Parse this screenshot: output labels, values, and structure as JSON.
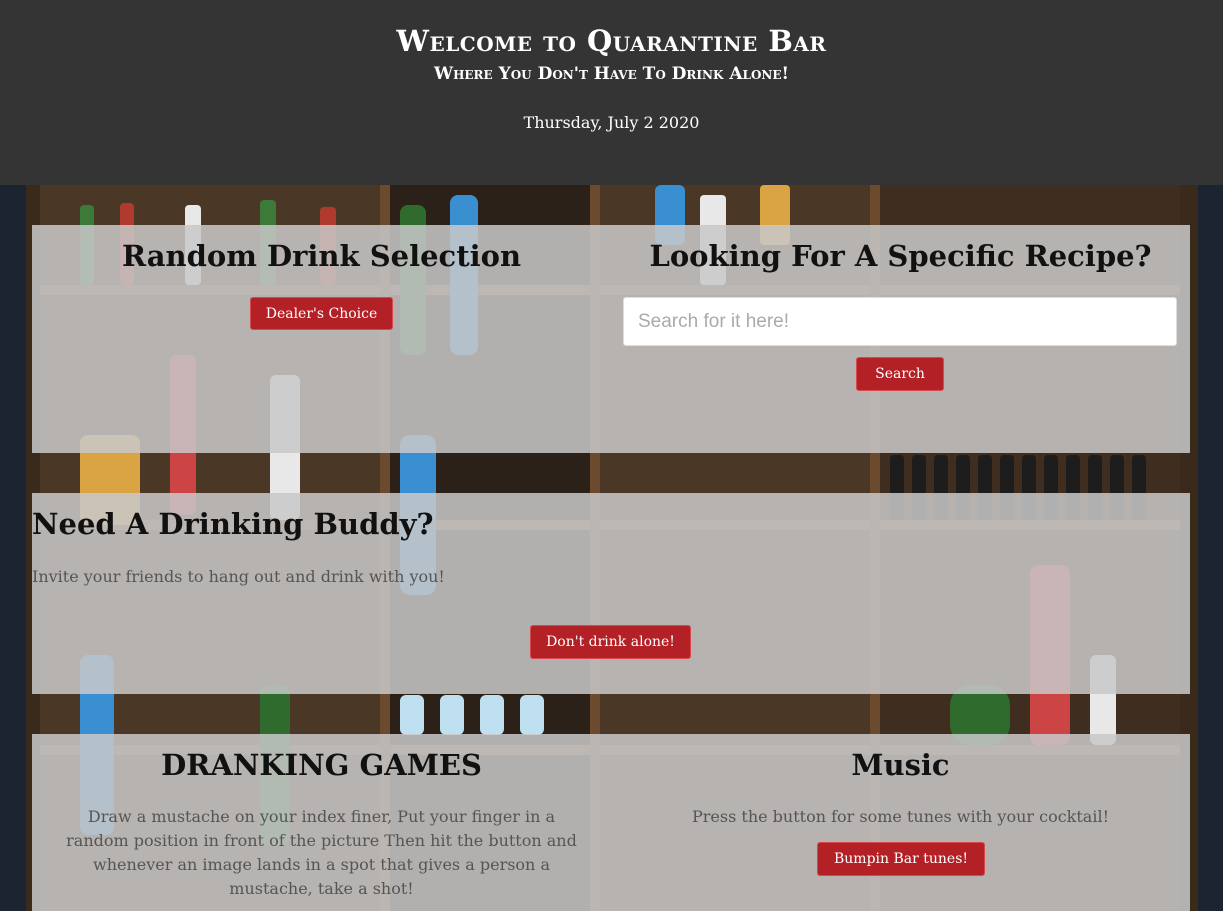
{
  "header": {
    "title": "Welcome to Quarantine Bar",
    "subtitle": "Where You Don't Have To Drink Alone!",
    "date": "Thursday, July 2 2020"
  },
  "random_drink": {
    "heading": "Random Drink Selection",
    "button_label": "Dealer's Choice"
  },
  "recipe_search": {
    "heading": "Looking For A Specific Recipe?",
    "placeholder": "Search for it here!",
    "value": "",
    "button_label": "Search"
  },
  "drinking_buddy": {
    "heading": "Need A Drinking Buddy?",
    "description": "Invite your friends to hang out and drink with you!",
    "button_label": "Don't drink alone!"
  },
  "games": {
    "heading": "DRANKING GAMES",
    "description": "Draw a mustache on your index finer, Put your finger in a random position in front of the picture Then hit the button and whenever an image lands in a spot that gives a person a mustache, take a shot!"
  },
  "music": {
    "heading": "Music",
    "description": "Press the button for some tunes with your cocktail!",
    "button_label": "Bumpin Bar tunes!"
  },
  "colors": {
    "header_bg": "#343434",
    "button_red": "#b32025",
    "panel_overlay": "#c8c8c8",
    "shelf_wood": "#6b4a2e"
  }
}
